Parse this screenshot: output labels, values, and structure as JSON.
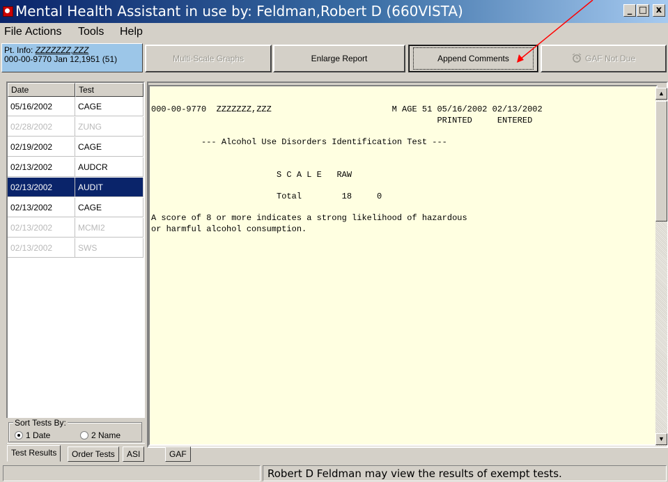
{
  "window": {
    "title": "Mental Health Assistant in use by: Feldman,Robert D  (660VISTA)",
    "minimize": "_",
    "maximize": "□",
    "close": "x"
  },
  "menu": {
    "items": [
      "File",
      "Actions",
      "Tools",
      "Help"
    ]
  },
  "patient_info": {
    "label": "Pt. Info:",
    "name": "ZZZZZZZ,ZZZ",
    "line2": "000-00-9770  Jan 12,1951 (51)"
  },
  "toolbar": {
    "multi_scale": "Multi-Scale Graphs",
    "enlarge": "Enlarge Report",
    "append": "Append Comments",
    "gaf": "GAF Not Due"
  },
  "list": {
    "headers": [
      "Date",
      "Test"
    ],
    "rows": [
      {
        "date": "05/16/2002",
        "test": "CAGE",
        "state": "normal"
      },
      {
        "date": "02/28/2002",
        "test": "ZUNG",
        "state": "disabled"
      },
      {
        "date": "02/19/2002",
        "test": "CAGE",
        "state": "normal"
      },
      {
        "date": "02/13/2002",
        "test": "AUDCR",
        "state": "normal"
      },
      {
        "date": "02/13/2002",
        "test": "AUDIT",
        "state": "selected"
      },
      {
        "date": "02/13/2002",
        "test": "CAGE",
        "state": "normal"
      },
      {
        "date": "02/13/2002",
        "test": "MCMI2",
        "state": "disabled"
      },
      {
        "date": "02/13/2002",
        "test": "SWS",
        "state": "disabled"
      }
    ]
  },
  "sort": {
    "label": "Sort Tests By:",
    "option1": "1 Date",
    "option2": "2 Name",
    "selected": "1 Date"
  },
  "report": {
    "lines": [
      "000-00-9770  ZZZZZZZ,ZZZ                        M AGE 51 05/16/2002 02/13/2002",
      "                                                         PRINTED     ENTERED",
      "",
      "          --- Alcohol Use Disorders Identification Test ---",
      "",
      "",
      "                         S C A L E   RAW",
      "",
      "                         Total        18     0",
      "",
      "A score of 8 or more indicates a strong likelihood of hazardous",
      "or harmful alcohol consumption."
    ]
  },
  "tabs": [
    "Test Results",
    "Order Tests",
    "ASI",
    "GAF"
  ],
  "status": {
    "left": "",
    "right": "Robert D Feldman may view the results of exempt tests."
  },
  "colors": {
    "selection": "#0a246a",
    "report_bg": "#ffffe1",
    "ptinfo_bg": "#9cc6e8",
    "annotation_arrow": "#ff0000"
  }
}
